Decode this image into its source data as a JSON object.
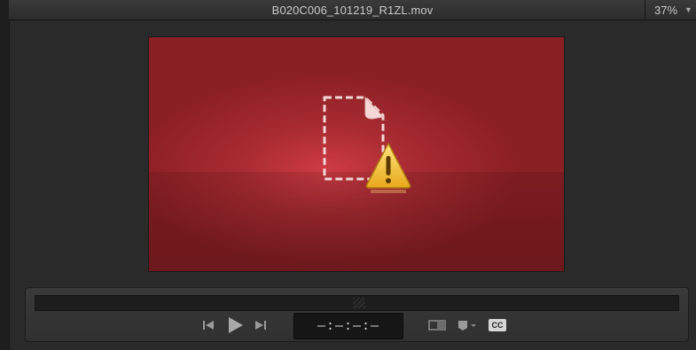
{
  "window": {
    "title": "B020C006_101219_R1ZL.mov",
    "zoom": "37%"
  },
  "viewer": {
    "state": "missing-media",
    "icon": "missing-file-warning-icon",
    "background_color": "#a82b31"
  },
  "controls": {
    "timecode": "—:—:—:—",
    "cc_label": "CC",
    "buttons": [
      "skip-back-icon",
      "play-icon",
      "skip-forward-icon",
      "view-mode-icon",
      "marker-dropdown-icon"
    ]
  }
}
